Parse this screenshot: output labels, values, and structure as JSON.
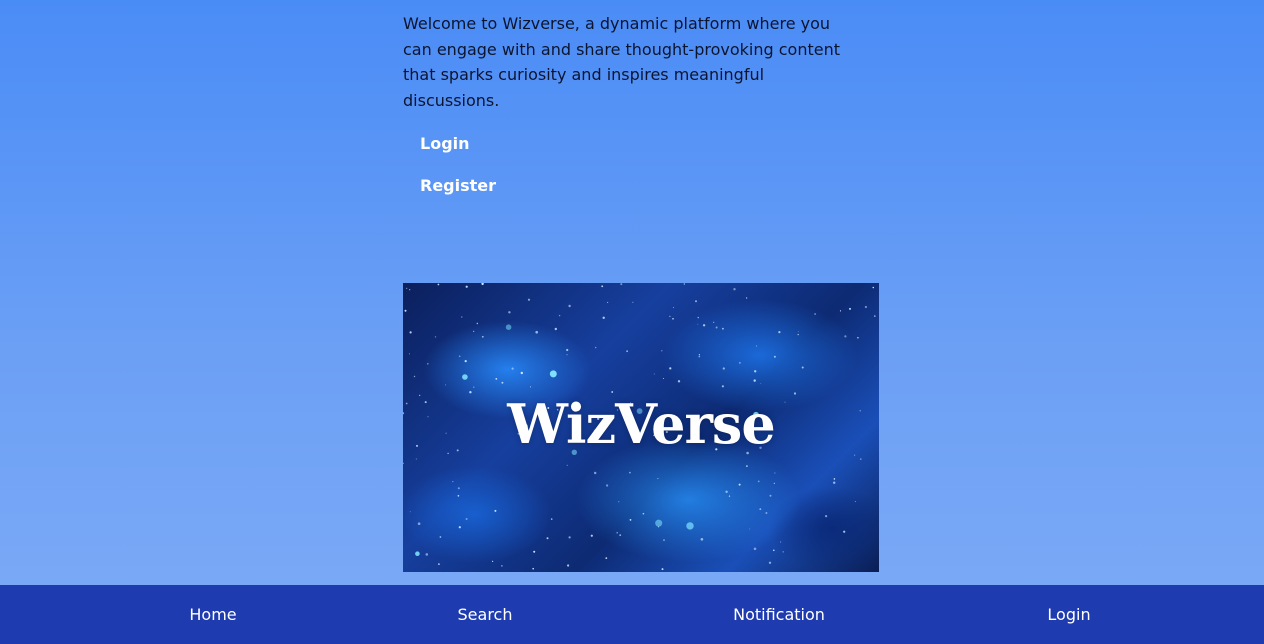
{
  "intro": {
    "text": "Welcome to Wizverse, a dynamic platform where you can engage with and share thought-provoking content that sparks curiosity and inspires meaningful discussions."
  },
  "auth": {
    "login_label": "Login",
    "register_label": "Register"
  },
  "hero": {
    "title": "WizVerse"
  },
  "bottom_nav": {
    "items": [
      {
        "label": "Home"
      },
      {
        "label": "Search"
      },
      {
        "label": "Notification"
      },
      {
        "label": "Login"
      }
    ]
  },
  "colors": {
    "background_top": "#4a8cf6",
    "background_bottom": "#7daaf6",
    "nav_bar": "#1e3bb0",
    "link_text": "#ffffff",
    "body_text": "#0c1530"
  }
}
